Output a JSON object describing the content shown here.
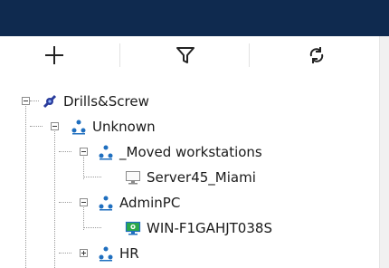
{
  "toolbar": {
    "add": "plus-icon",
    "filter": "filter-icon",
    "refresh": "refresh-icon"
  },
  "tree": {
    "root": {
      "label": "Drills&Screw",
      "icon": "network-icon"
    },
    "unknown": {
      "label": "Unknown",
      "icon": "group-icon"
    },
    "moved": {
      "label": "_Moved workstations",
      "icon": "group-icon"
    },
    "server": {
      "label": "Server45_Miami",
      "icon": "computer-offline-icon"
    },
    "adminpc": {
      "label": "AdminPC",
      "icon": "group-icon"
    },
    "win": {
      "label": "WIN-F1GAHJT038S",
      "icon": "computer-online-icon"
    },
    "hr": {
      "label": "HR",
      "icon": "group-icon"
    }
  },
  "colors": {
    "header": "#0f2a4f",
    "group_icon": "#1f6fbf",
    "online": "#2aa84a"
  }
}
